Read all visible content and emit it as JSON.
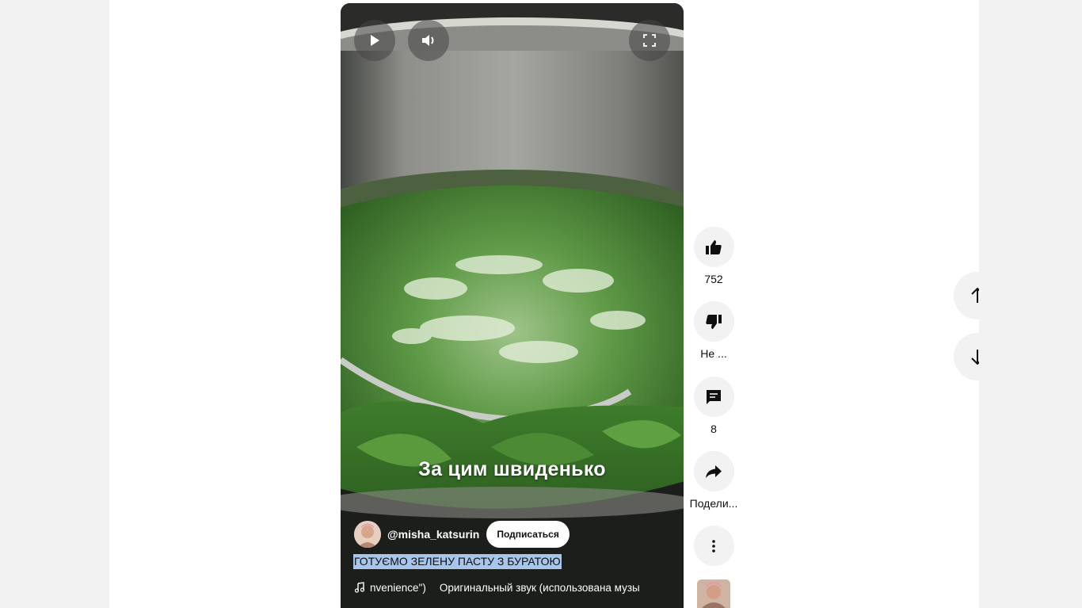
{
  "video": {
    "caption": "За цим швиденько",
    "channel_handle": "@misha_katsurin",
    "subscribe_label": "Подписаться",
    "title": "ГОТУЄМО ЗЕЛЕНУ ПАСТУ З БУРАТОЮ",
    "sound_text_1": "nvenience\")",
    "sound_text_2": "Оригинальный звук (использована музы"
  },
  "controls": {
    "play_icon": "play-icon",
    "volume_icon": "volume-icon",
    "fullscreen_icon": "fullscreen-icon"
  },
  "actions": {
    "like_count": "752",
    "dislike_label": "Не ...",
    "comments_count": "8",
    "share_label": "Подели..."
  },
  "colors": {
    "page_bg": "#f2f2f2",
    "content_bg": "#ffffff",
    "title_highlight": "#a8c5ec"
  }
}
